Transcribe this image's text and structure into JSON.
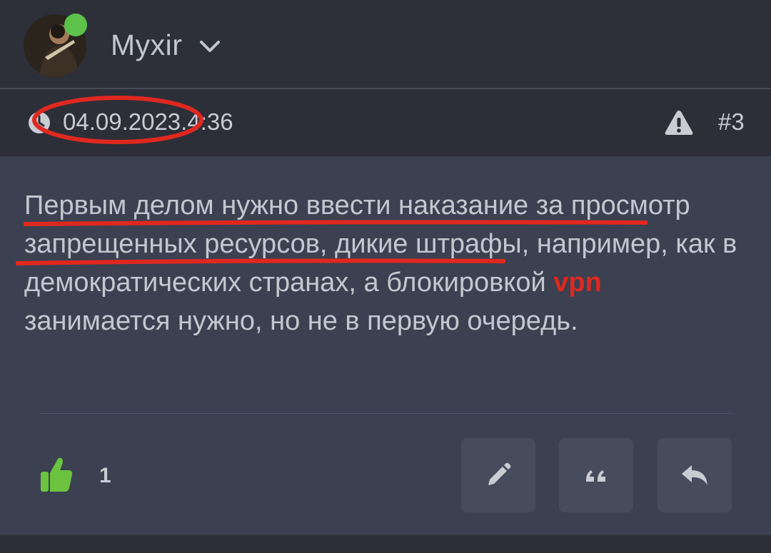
{
  "user": {
    "name": "Myxir",
    "online": true
  },
  "meta": {
    "date": "04.09.2023.",
    "time": "4:36",
    "post_number": "#3"
  },
  "post": {
    "text_before": "Первым делом нужно ввести наказание за просмотр запрещенных ресурсов, дикие штрафы, например, как в демократических странах, а блокировкой ",
    "highlight": "vpn",
    "text_after": " занимается нужно, но не в первую очередь."
  },
  "reactions": {
    "like_count": "1"
  },
  "actions": {
    "edit": "edit-icon",
    "quote": "quote-icon",
    "reply": "reply-icon"
  },
  "colors": {
    "accent_red": "#e0281f",
    "online_green": "#5cc24a",
    "like_green": "#6bc33e"
  }
}
